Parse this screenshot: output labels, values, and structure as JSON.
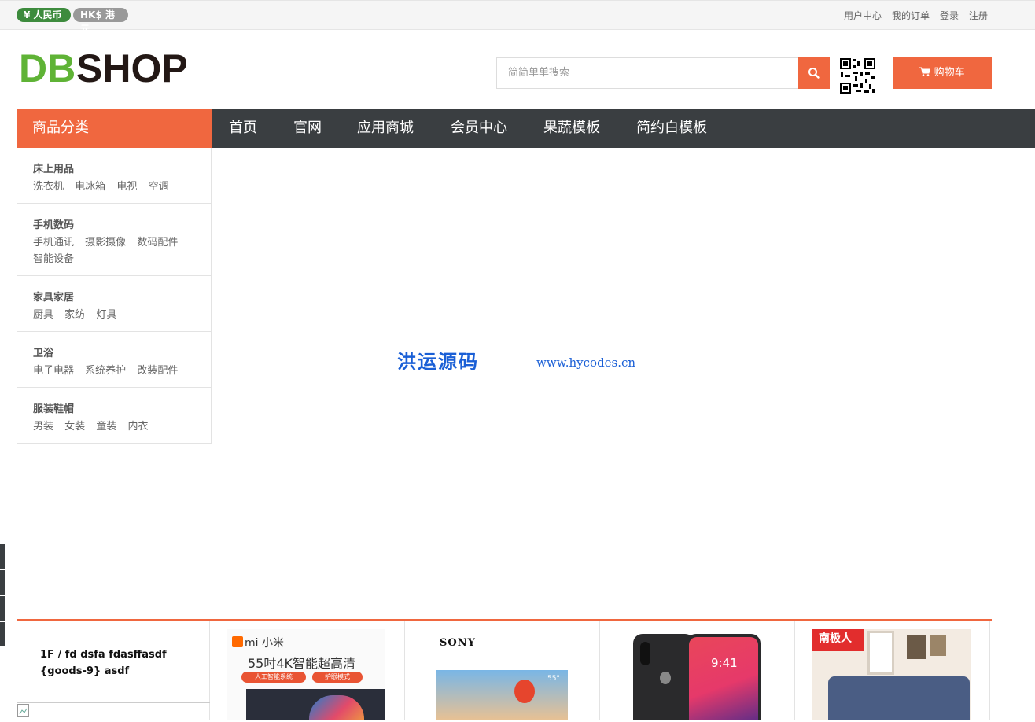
{
  "topbar": {
    "currencies": [
      "¥ 人民币",
      "HK$ 港元"
    ],
    "links": [
      "用户中心",
      "我的订单",
      "登录",
      "注册"
    ]
  },
  "header": {
    "logo_text_green": "DB",
    "logo_text_dark": "SHOP",
    "search_placeholder": "简简单单搜索",
    "cart_label": "购物车"
  },
  "nav": {
    "category_title": "商品分类",
    "items": [
      "首页",
      "官网",
      "应用商城",
      "会员中心",
      "果蔬模板",
      "简约白模板"
    ]
  },
  "categories": [
    {
      "title": "床上用品",
      "subs": [
        "洗衣机",
        "电冰箱",
        "电视",
        "空调"
      ]
    },
    {
      "title": "手机数码",
      "subs": [
        "手机通讯",
        "摄影摄像",
        "数码配件",
        "智能设备"
      ]
    },
    {
      "title": "家具家居",
      "subs": [
        "厨具",
        "家纺",
        "灯具"
      ]
    },
    {
      "title": "卫浴",
      "subs": [
        "电子电器",
        "系统养护",
        "改装配件"
      ]
    },
    {
      "title": "服装鞋帽",
      "subs": [
        "男装",
        "女装",
        "童装",
        "内衣"
      ]
    }
  ],
  "banner": {
    "watermark_cn": "洪运源码",
    "watermark_url": "www.hycodes.cn"
  },
  "floor": {
    "title_line1": "1F / fd dsfa fdasffasdf",
    "title_line2": "{goods-9} asdf",
    "products": [
      {
        "brand": "mi 小米",
        "headline": "55吋4K智能超高清",
        "tag1": "人工智能系统",
        "tag2": "护眼模式"
      },
      {
        "brand": "SONY",
        "size": "55\""
      },
      {
        "clock": "9:41"
      },
      {
        "brand": "南极人"
      }
    ]
  },
  "colors": {
    "accent": "#f0673f",
    "nav_bg": "#3a3e41",
    "logo_green": "#5fb336"
  }
}
